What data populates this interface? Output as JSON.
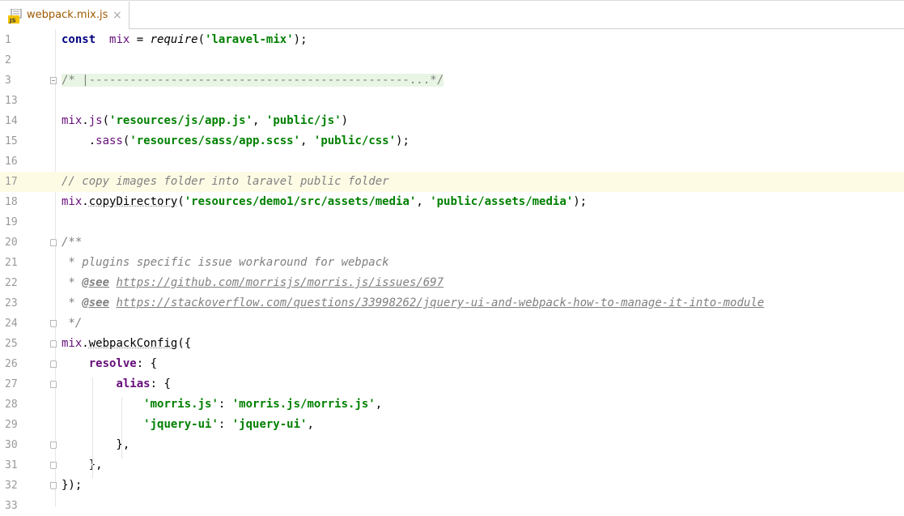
{
  "tab": {
    "title": "webpack.mix.js",
    "icon": "js-file-icon",
    "close": "×"
  },
  "colors": {
    "highlight_line": "#fefbe5",
    "string": "#008000",
    "keyword": "#000080",
    "comment": "#808080"
  },
  "lines": [
    {
      "n": "1",
      "parts": [
        [
          "kw",
          "const"
        ],
        [
          "",
          "  "
        ],
        [
          "ident",
          "mix"
        ],
        [
          "",
          " = "
        ],
        [
          "call",
          "require"
        ],
        [
          "",
          "("
        ],
        [
          "str",
          "'laravel-mix'"
        ],
        [
          "",
          ");"
        ]
      ]
    },
    {
      "n": "2",
      "parts": []
    },
    {
      "n": "3",
      "parts": [
        [
          "collapsed",
          "/* |-----------------------------------------------...*/"
        ]
      ]
    },
    {
      "n": "13",
      "parts": []
    },
    {
      "n": "14",
      "parts": [
        [
          "ident",
          "mix"
        ],
        [
          "",
          "."
        ],
        [
          "ident",
          "js"
        ],
        [
          "",
          "("
        ],
        [
          "str",
          "'resources/js/app.js'"
        ],
        [
          "",
          ", "
        ],
        [
          "str",
          "'public/js'"
        ],
        [
          "",
          ")"
        ]
      ]
    },
    {
      "n": "15",
      "parts": [
        [
          "",
          "    ."
        ],
        [
          "ident",
          "sass"
        ],
        [
          "",
          "("
        ],
        [
          "str",
          "'resources/sass/app.scss'"
        ],
        [
          "",
          ", "
        ],
        [
          "str",
          "'public/css'"
        ],
        [
          "",
          ");"
        ]
      ]
    },
    {
      "n": "16",
      "parts": []
    },
    {
      "n": "17",
      "parts": [
        [
          "cmt",
          "// copy images folder into laravel public folder"
        ]
      ]
    },
    {
      "n": "18",
      "parts": [
        [
          "ident",
          "mix"
        ],
        [
          "",
          "."
        ],
        [
          "meth",
          "copyDirectory"
        ],
        [
          "",
          "("
        ],
        [
          "str",
          "'resources/demo1/src/assets/media'"
        ],
        [
          "",
          ", "
        ],
        [
          "str",
          "'public/assets/media'"
        ],
        [
          "",
          ");"
        ]
      ]
    },
    {
      "n": "19",
      "parts": []
    },
    {
      "n": "20",
      "parts": [
        [
          "cmt",
          "/**"
        ]
      ]
    },
    {
      "n": "21",
      "parts": [
        [
          "cmt",
          " * plugins specific issue workaround for webpack"
        ]
      ]
    },
    {
      "n": "22",
      "parts": [
        [
          "cmt",
          " * "
        ],
        [
          "doctag",
          "@see"
        ],
        [
          "cmt",
          " "
        ],
        [
          "doclink",
          "https://github.com/morrisjs/morris.js/issues/697"
        ]
      ]
    },
    {
      "n": "23",
      "parts": [
        [
          "cmt",
          " * "
        ],
        [
          "doctag",
          "@see"
        ],
        [
          "cmt",
          " "
        ],
        [
          "doclink",
          "https://stackoverflow.com/questions/33998262/jquery-ui-and-webpack-how-to-manage-it-into-module"
        ]
      ]
    },
    {
      "n": "24",
      "parts": [
        [
          "cmt",
          " */"
        ]
      ]
    },
    {
      "n": "25",
      "parts": [
        [
          "ident",
          "mix"
        ],
        [
          "",
          "."
        ],
        [
          "meth",
          "webpackConfig"
        ],
        [
          "",
          "({"
        ]
      ]
    },
    {
      "n": "26",
      "parts": [
        [
          "",
          "    "
        ],
        [
          "prop",
          "resolve"
        ],
        [
          "",
          ": {"
        ]
      ]
    },
    {
      "n": "27",
      "parts": [
        [
          "",
          "        "
        ],
        [
          "prop",
          "alias"
        ],
        [
          "",
          ": {"
        ]
      ]
    },
    {
      "n": "28",
      "parts": [
        [
          "",
          "            "
        ],
        [
          "str",
          "'morris.js'"
        ],
        [
          "",
          ": "
        ],
        [
          "str",
          "'morris.js/morris.js'"
        ],
        [
          "",
          ","
        ]
      ]
    },
    {
      "n": "29",
      "parts": [
        [
          "",
          "            "
        ],
        [
          "str",
          "'jquery-ui'"
        ],
        [
          "",
          ": "
        ],
        [
          "str",
          "'jquery-ui'"
        ],
        [
          "",
          ","
        ]
      ]
    },
    {
      "n": "30",
      "parts": [
        [
          "",
          "        },"
        ]
      ]
    },
    {
      "n": "31",
      "parts": [
        [
          "",
          "    },"
        ]
      ]
    },
    {
      "n": "32",
      "parts": [
        [
          "",
          "});"
        ]
      ]
    },
    {
      "n": "33",
      "parts": []
    }
  ]
}
